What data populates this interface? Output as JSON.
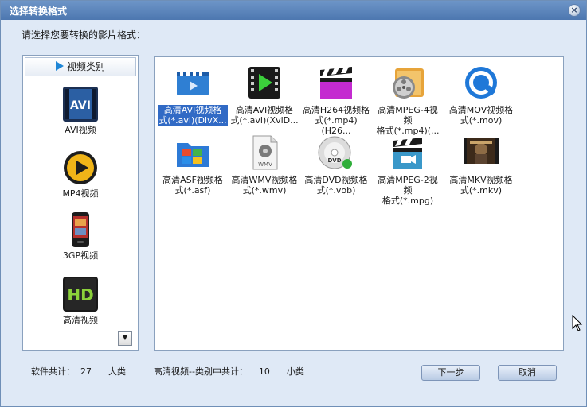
{
  "window": {
    "title": "选择转换格式",
    "close_label": "×"
  },
  "prompt": "请选择您要转换的影片格式：",
  "categories": {
    "header": "视频类别",
    "items": [
      {
        "label": "AVI视频",
        "icon": "avi-icon"
      },
      {
        "label": "MP4视频",
        "icon": "mp4-play-icon"
      },
      {
        "label": "3GP视频",
        "icon": "phone-icon"
      },
      {
        "label": "高清视频",
        "icon": "hd-icon"
      }
    ],
    "scroll_label": "▼"
  },
  "formats": [
    {
      "line1": "高清AVI视频格",
      "line2": "式(*.avi)(DivX...",
      "icon": "film-clip-icon",
      "selected": true
    },
    {
      "line1": "高清AVI视频格",
      "line2": "式(*.avi)(XviD...",
      "icon": "play-film-icon"
    },
    {
      "line1": "高清H264视频格",
      "line2": "式(*.mp4)(H26...",
      "icon": "clapperboard-icon"
    },
    {
      "line1": "高清MPEG-4视频",
      "line2": "格式(*.mp4)(...",
      "icon": "film-reel-icon"
    },
    {
      "line1": "高清MOV视频格",
      "line2": "式(*.mov)",
      "icon": "quicktime-icon"
    },
    {
      "line1": "高清ASF视频格",
      "line2": "式(*.asf)",
      "icon": "windows-folder-icon"
    },
    {
      "line1": "高清WMV视频格",
      "line2": "式(*.wmv)",
      "icon": "wmv-file-icon"
    },
    {
      "line1": "高清DVD视频格",
      "line2": "式(*.vob)",
      "icon": "dvd-disc-icon"
    },
    {
      "line1": "高清MPEG-2视频",
      "line2": "格式(*.mpg)",
      "icon": "clapper-film-icon"
    },
    {
      "line1": "高清MKV视频格",
      "line2": "式(*.mkv)",
      "icon": "movie-poster-icon"
    }
  ],
  "status": {
    "software_total": "软件共计：  27      大类",
    "category_total": "高清视频--类别中共计：    10      小类"
  },
  "buttons": {
    "next": "下一步",
    "cancel": "取消"
  },
  "colors": {
    "accent": "#316ac5",
    "title_bar": "#4d77b0",
    "panel_bg": "#dfe9f6"
  }
}
